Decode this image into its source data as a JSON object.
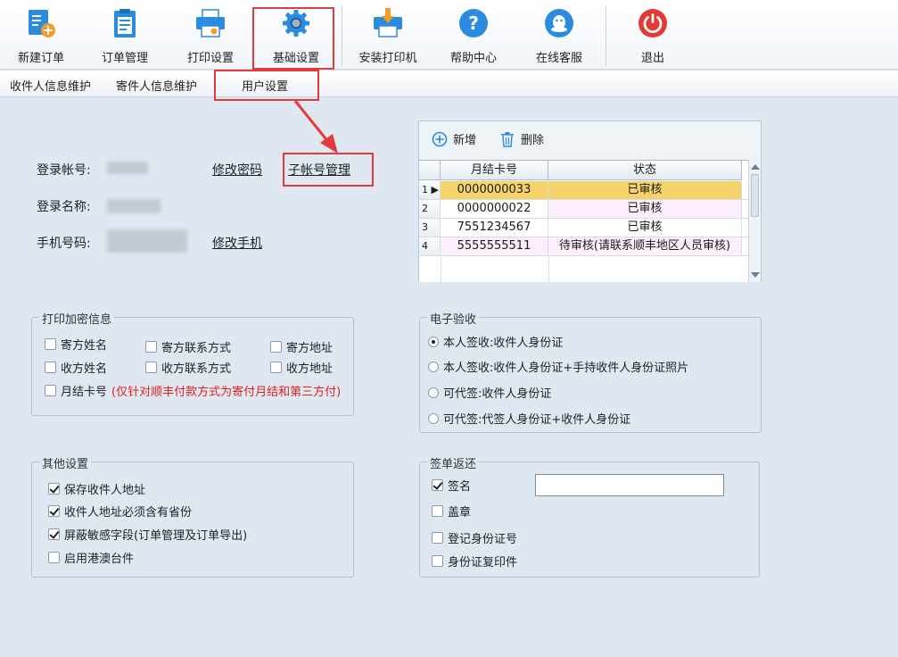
{
  "toolbar": {
    "items": [
      {
        "label": "新建订单",
        "icon": "new-order-icon"
      },
      {
        "label": "订单管理",
        "icon": "clipboard-icon"
      },
      {
        "label": "打印设置",
        "icon": "printer-settings-icon"
      },
      {
        "label": "基础设置",
        "icon": "gear-icon"
      },
      {
        "label": "安装打印机",
        "icon": "install-printer-icon"
      },
      {
        "label": "帮助中心",
        "icon": "help-icon"
      },
      {
        "label": "在线客服",
        "icon": "chat-icon"
      },
      {
        "label": "退出",
        "icon": "power-icon"
      }
    ],
    "active": "基础设置"
  },
  "subtabs": [
    "收件人信息维护",
    "寄件人信息维护",
    "用户设置"
  ],
  "account": {
    "login_account_label": "登录帐号:",
    "login_name_label": "登录名称:",
    "phone_label": "手机号码:",
    "change_password": "修改密码",
    "sub_account": "子帐号管理",
    "change_phone": "修改手机"
  },
  "grid": {
    "add_label": "新增",
    "delete_label": "删除",
    "headers": [
      "月结卡号",
      "状态"
    ],
    "rows": [
      {
        "num": "1",
        "card": "0000000033",
        "status": "已审核",
        "selected": true
      },
      {
        "num": "2",
        "card": "0000000022",
        "status": "已审核"
      },
      {
        "num": "3",
        "card": "7551234567",
        "status": "已审核"
      },
      {
        "num": "4",
        "card": "5555555511",
        "status": "待审核(请联系顺丰地区人员审核)"
      }
    ]
  },
  "print_encrypt": {
    "title": "打印加密信息",
    "options": [
      {
        "label": "寄方姓名",
        "checked": false
      },
      {
        "label": "寄方联系方式",
        "checked": false
      },
      {
        "label": "寄方地址",
        "checked": false
      },
      {
        "label": "收方姓名",
        "checked": false
      },
      {
        "label": "收方联系方式",
        "checked": false
      },
      {
        "label": "收方地址",
        "checked": false
      },
      {
        "label": "月结卡号",
        "checked": false
      }
    ],
    "note": "(仅针对顺丰付款方式为寄付月结和第三方付)"
  },
  "e_receipt": {
    "title": "电子验收",
    "options": [
      {
        "label": "本人签收:收件人身份证",
        "checked": true
      },
      {
        "label": "本人签收:收件人身份证+手持收件人身份证照片",
        "checked": false
      },
      {
        "label": "可代签:收件人身份证",
        "checked": false
      },
      {
        "label": "可代签:代签人身份证+收件人身份证",
        "checked": false
      }
    ]
  },
  "other": {
    "title": "其他设置",
    "options": [
      {
        "label": "保存收件人地址",
        "checked": true
      },
      {
        "label": "收件人地址必须含有省份",
        "checked": true
      },
      {
        "label": "屏蔽敏感字段(订单管理及订单导出)",
        "checked": true
      },
      {
        "label": "启用港澳台件",
        "checked": false
      }
    ]
  },
  "sign_return": {
    "title": "签单返还",
    "options": [
      {
        "label": "签名",
        "checked": true
      },
      {
        "label": "盖章",
        "checked": false
      },
      {
        "label": "登记身份证号",
        "checked": false
      },
      {
        "label": "身份证复印件",
        "checked": false
      }
    ],
    "signature_value": ""
  },
  "colors": {
    "highlight": "#e23b3b",
    "selected_row": "#f5d36a",
    "pink_row": "#fdeefb",
    "accent": "#2b8be0"
  }
}
